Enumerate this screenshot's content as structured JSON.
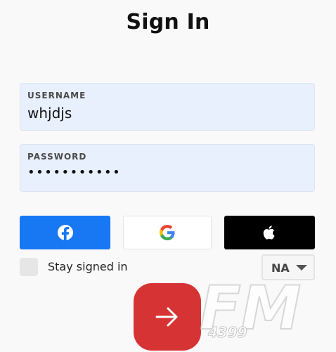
{
  "title": "Sign In",
  "username": {
    "label": "USERNAME",
    "value": "whjdjs"
  },
  "password": {
    "label": "PASSWORD",
    "value": "•••••••••••"
  },
  "social": {
    "facebook_icon": "facebook-icon",
    "google_icon": "google-icon",
    "apple_icon": "apple-icon",
    "colors": {
      "facebook": "#1877f2",
      "google_bg": "#ffffff",
      "apple": "#000000"
    }
  },
  "stay_signed_in": {
    "label": "Stay signed in",
    "checked": false
  },
  "region": {
    "value": "NA"
  },
  "submit": {
    "icon": "arrow-right-icon",
    "color": "#d63434"
  },
  "watermark": {
    "brand": "FM",
    "number": "4399"
  }
}
